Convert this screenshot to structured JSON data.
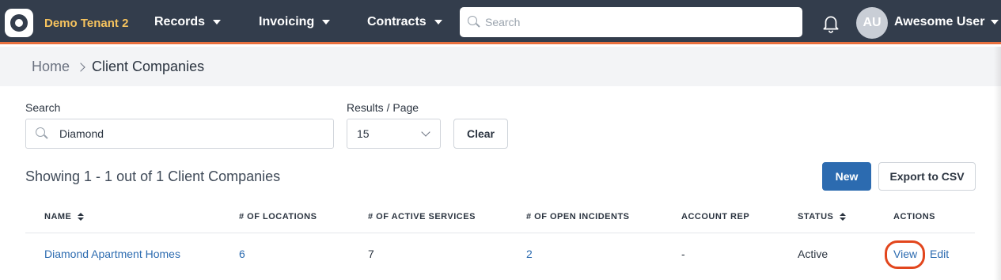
{
  "header": {
    "tenant": "Demo Tenant 2",
    "nav": [
      {
        "label": "Records"
      },
      {
        "label": "Invoicing"
      },
      {
        "label": "Contracts"
      }
    ],
    "search_placeholder": "Search",
    "avatar_initials": "AU",
    "user_name": "Awesome User"
  },
  "breadcrumb": {
    "home": "Home",
    "current": "Client Companies"
  },
  "filters": {
    "search_label": "Search",
    "search_value": "Diamond",
    "results_label": "Results / Page",
    "results_value": "15",
    "clear_label": "Clear"
  },
  "summary": {
    "showing_text": "Showing 1 - 1 out of 1 Client Companies",
    "new_label": "New",
    "export_label": "Export to CSV"
  },
  "table": {
    "columns": [
      "NAME",
      "# OF LOCATIONS",
      "# OF ACTIVE SERVICES",
      "# OF OPEN INCIDENTS",
      "ACCOUNT REP",
      "STATUS",
      "ACTIONS"
    ],
    "rows": [
      {
        "name": "Diamond Apartment Homes",
        "locations": "6",
        "active_services": "7",
        "open_incidents": "2",
        "account_rep": "-",
        "status": "Active",
        "view_label": "View",
        "edit_label": "Edit"
      }
    ]
  },
  "colors": {
    "topbar": "#333d4c",
    "accent": "#e8703f",
    "tenant": "#f6c35e",
    "link": "#2c6bb0",
    "primary_button": "#2c6bb0",
    "highlight_circle": "#e2461d"
  }
}
